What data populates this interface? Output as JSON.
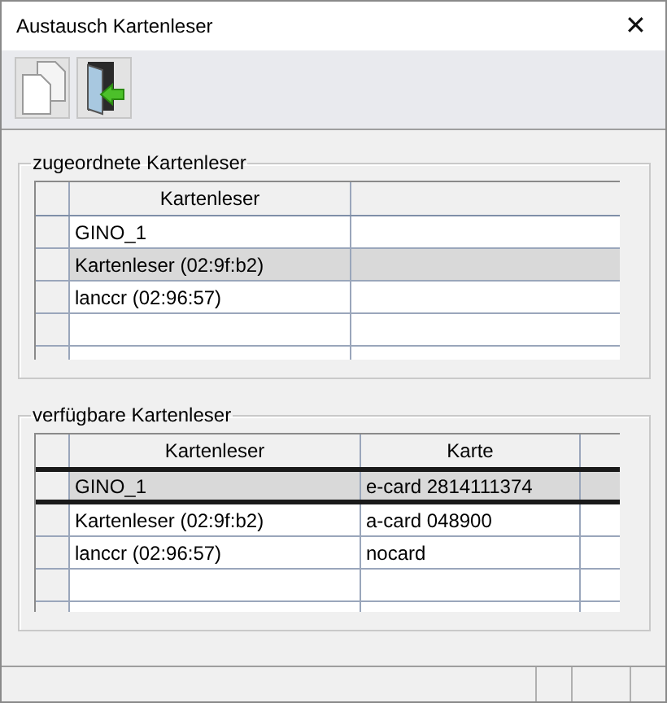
{
  "window": {
    "title": "Austausch Kartenleser",
    "close": "✕"
  },
  "toolbar": [
    {
      "kind": "copy"
    },
    {
      "kind": "exit"
    }
  ],
  "groups": [
    {
      "title": "zugeordnete Kartenleser",
      "focused": false,
      "columns": [
        "Kartenleser",
        ""
      ],
      "rows": [
        {
          "cells": [
            "GINO_1",
            ""
          ],
          "selected": false
        },
        {
          "cells": [
            "Kartenleser (02:9f:b2)",
            ""
          ],
          "selected": true
        },
        {
          "cells": [
            "lanccr (02:96:57)",
            ""
          ],
          "selected": false
        }
      ]
    },
    {
      "title": "verfügbare Kartenleser",
      "focused": true,
      "columns": [
        "Kartenleser",
        "Karte",
        ""
      ],
      "rows": [
        {
          "cells": [
            "GINO_1",
            "e-card 2814111374",
            ""
          ],
          "selected": true
        },
        {
          "cells": [
            "Kartenleser (02:9f:b2)",
            "a-card 048900",
            ""
          ],
          "selected": false
        },
        {
          "cells": [
            "lanccr (02:96:57)",
            "nocard",
            ""
          ],
          "selected": false
        }
      ]
    }
  ]
}
